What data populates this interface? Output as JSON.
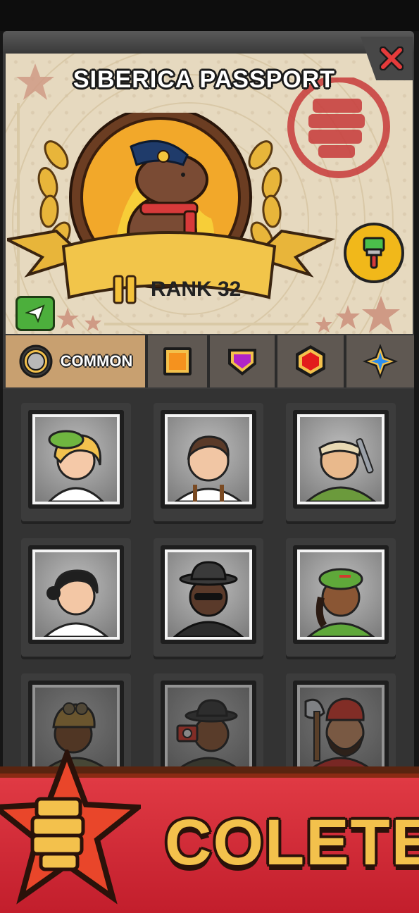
{
  "passport": {
    "title": "SIBERICA PASSPORT",
    "rank_label": "RANK 32",
    "badge_color": "#e8c044"
  },
  "tabs": [
    {
      "label": "COMMON",
      "icon": "silver-circle-icon",
      "color": "#b8b8b8"
    },
    {
      "label": "",
      "icon": "orange-square-icon",
      "color": "#f5921e"
    },
    {
      "label": "",
      "icon": "purple-shield-icon",
      "color": "#b024c8"
    },
    {
      "label": "",
      "icon": "red-hexagon-icon",
      "color": "#e21c1c"
    },
    {
      "label": "",
      "icon": "blue-star-icon",
      "color": "#2b8ef0"
    }
  ],
  "characters": [
    {
      "name": "blonde-girl-green-cap",
      "hair": "#f2c14e",
      "skin": "#f5c9a8",
      "cloth": "#ffffff",
      "hat": "#6fb640"
    },
    {
      "name": "man-white-shirt-suspenders",
      "hair": "#5a3a28",
      "skin": "#f1c6a4",
      "cloth": "#ffffff",
      "hat": "none"
    },
    {
      "name": "mechanic-bandana-wrench",
      "hair": "#2a2a2a",
      "skin": "#e9b98c",
      "cloth": "#6b9a3c",
      "hat": "#e8d9b4"
    },
    {
      "name": "doctor-black-hair",
      "hair": "#1f1f1f",
      "skin": "#f3c7a5",
      "cloth": "#ffffff",
      "hat": "none"
    },
    {
      "name": "agent-fedora-sunglasses",
      "hair": "#2a2a2a",
      "skin": "#5a3a2a",
      "cloth": "#2c2c2c",
      "hat": "#3a3a3a"
    },
    {
      "name": "woman-green-cap-overalls",
      "hair": "#2a1a12",
      "skin": "#8a5634",
      "cloth": "#5fa83a",
      "hat": "#5fa83a"
    },
    {
      "name": "pilot-goggles",
      "hair": "#3a2a1a",
      "skin": "#7a4a2a",
      "cloth": "#6a6a4a",
      "hat": "#a8823c"
    },
    {
      "name": "photographer-fedora",
      "hair": "#2a1a12",
      "skin": "#8a5634",
      "cloth": "#4a4a3a",
      "hat": "#3a3a3a"
    },
    {
      "name": "lumberjack-axe",
      "hair": "#3a2418",
      "skin": "#c48a62",
      "cloth": "#c2302a",
      "hat": "#d23a2e"
    }
  ],
  "collect": {
    "label": "COLETE",
    "color": "#f3c14c"
  }
}
